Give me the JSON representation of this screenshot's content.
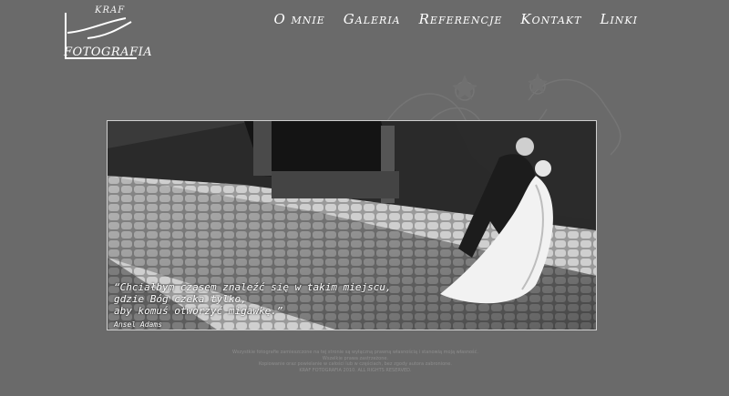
{
  "logo": {
    "mark": "KRAF",
    "word": "FOTOGRAFIA"
  },
  "nav": {
    "items": [
      "O mnie",
      "Galeria",
      "Referencje",
      "Kontakt",
      "Linki"
    ]
  },
  "hero": {
    "quote_lines": [
      "“Chciałbym czasem znaleźć się w takim miejscu,",
      "gdzie Bóg czeka tylko,",
      "aby komuś otworzyć migawkę.”"
    ],
    "author": "Ansel Adams"
  },
  "footer": {
    "lines": [
      "Wszystkie fotografie zamieszczone na tej stronie są wyłączną prawną własnością i stanowią moją własność.",
      "Wszelkie prawa zastrzeżone.",
      "Kopiowanie oraz powielanie w całości lub w częściach, bez zgody autora zabronione.",
      "KRAF FOTOGRAFIA 2010. ALL RIGHTS RESERVED."
    ]
  },
  "colors": {
    "background": "#6a6a6a",
    "text": "#ffffff",
    "footer": "#8d8d8d"
  }
}
